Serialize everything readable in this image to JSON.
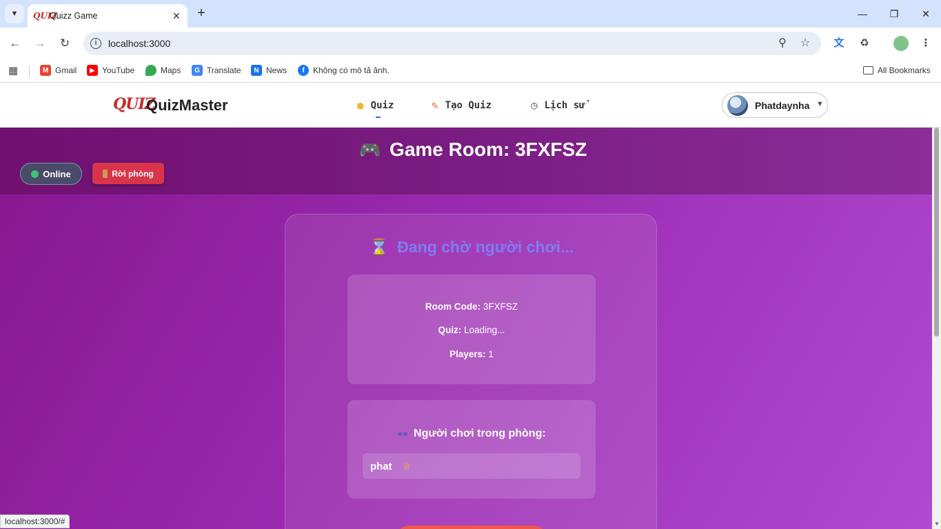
{
  "browser": {
    "tab_title": "Quizz Game",
    "tab_favicon": "QUIZ",
    "url": "localhost:3000",
    "status_url": "localhost:3000/#",
    "bookmarks": [
      {
        "label": "Gmail",
        "icon": "gmail-icon",
        "color": "#ea4335"
      },
      {
        "label": "YouTube",
        "icon": "youtube-icon",
        "color": "#ff0000"
      },
      {
        "label": "Maps",
        "icon": "maps-icon",
        "color": "#34a853"
      },
      {
        "label": "Translate",
        "icon": "translate-icon",
        "color": "#4285f4"
      },
      {
        "label": "News",
        "icon": "news-icon",
        "color": "#1a73e8"
      },
      {
        "label": "Không có mô tả ảnh.",
        "icon": "facebook-icon",
        "color": "#1877f2"
      }
    ],
    "all_bookmarks": "All Bookmarks"
  },
  "app": {
    "logo_mark": "QUIZ",
    "logo_text": "QuizMaster",
    "nav": {
      "quiz": "Quiz",
      "create": "Tạo Quiz",
      "history": "Lịch sử"
    },
    "user": {
      "name": "Phatdaynha"
    }
  },
  "room": {
    "title": "Game Room: 3FXFSZ",
    "status": "Online",
    "leave": "Rời phòng",
    "waiting": "Đang chờ người chơi...",
    "info": {
      "code_label": "Room Code:",
      "code_value": "3FXFSZ",
      "quiz_label": "Quiz:",
      "quiz_value": "Loading...",
      "players_label": "Players:",
      "players_value": "1"
    },
    "players_title": "Người chơi trong phòng:",
    "players": [
      {
        "name": "phat",
        "is_host": true
      }
    ]
  },
  "colors": {
    "accent": "#1a73e8",
    "leave_button": "#d9344b",
    "online_dot": "#43c07a",
    "waiting_title": "#7d7ef0"
  }
}
